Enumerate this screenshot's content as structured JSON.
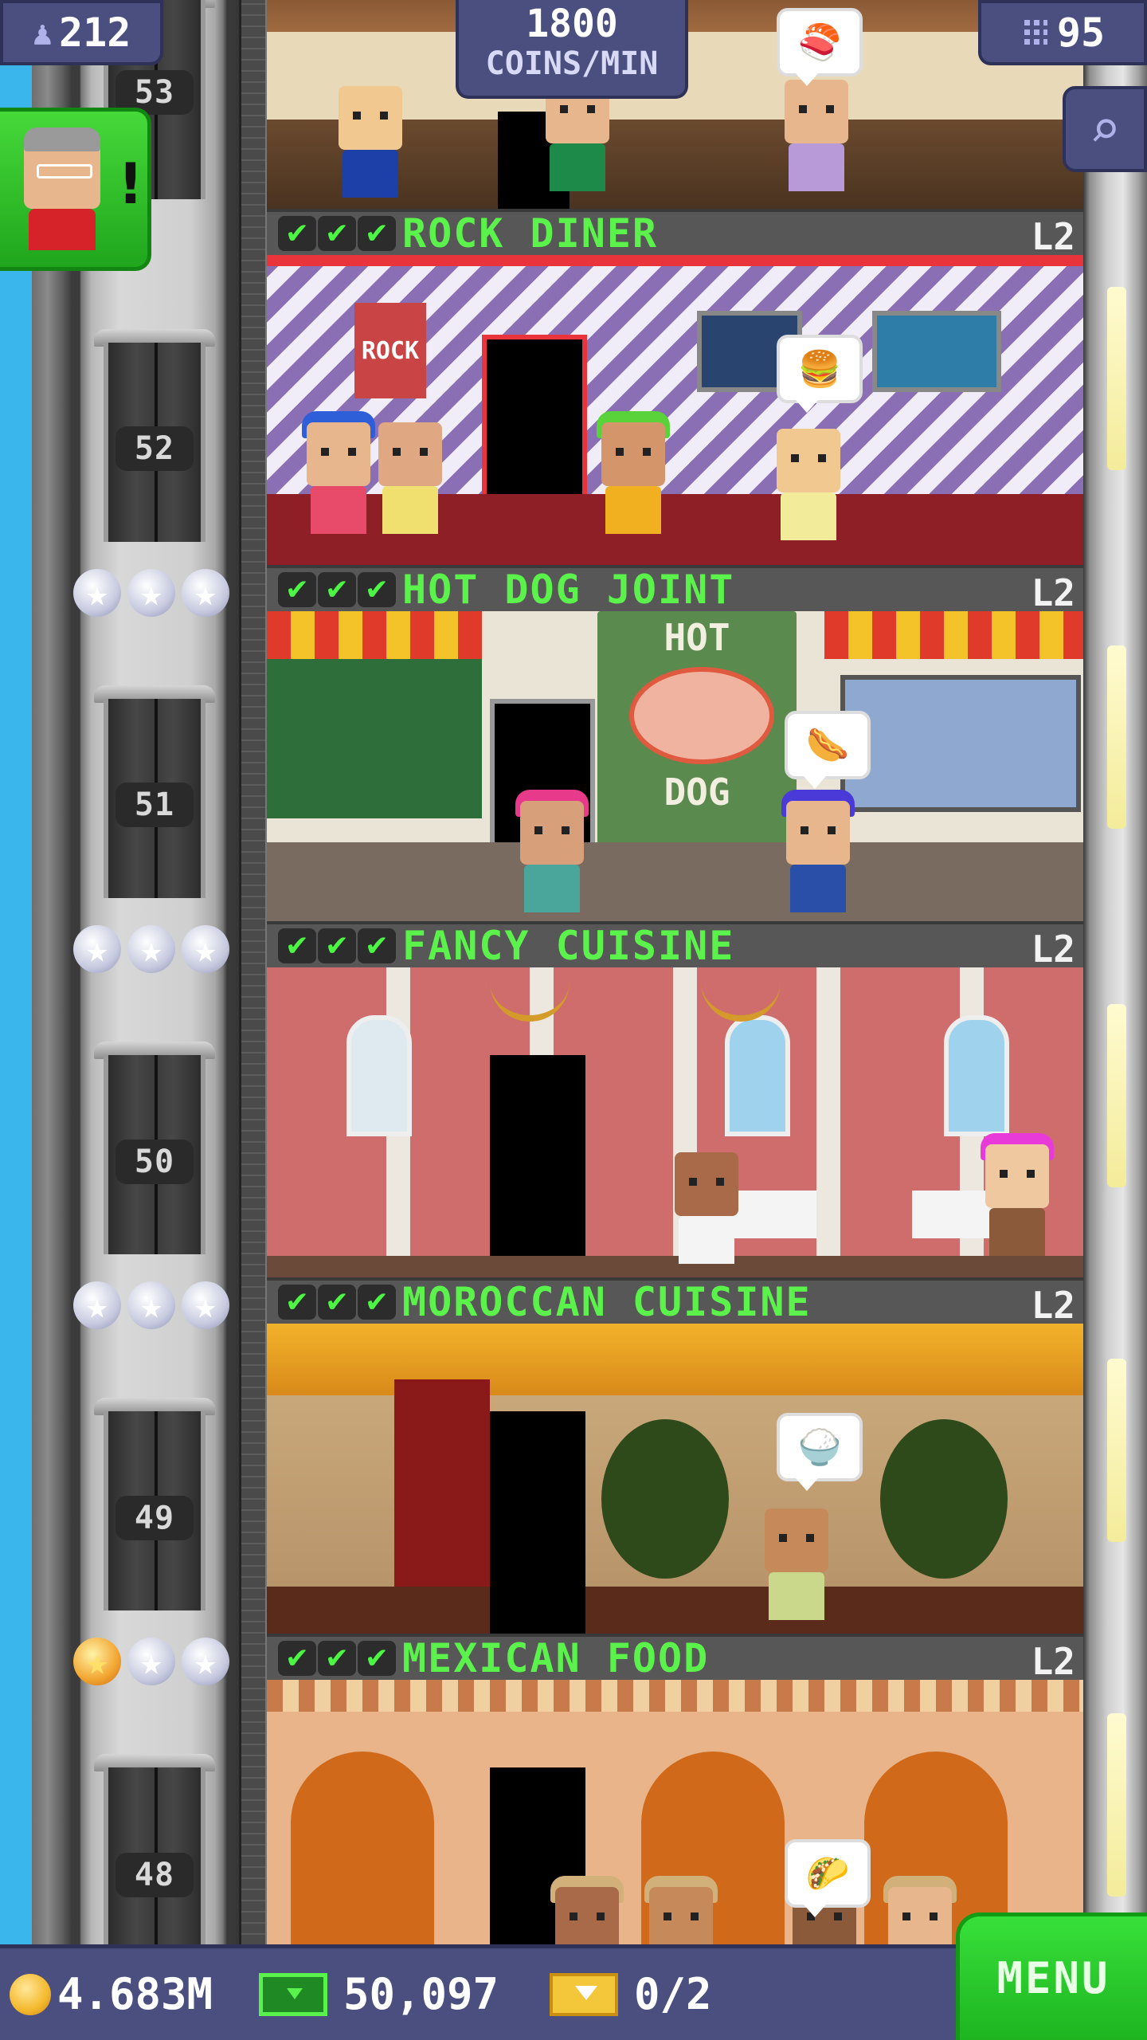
{
  "hud": {
    "population": "212",
    "coins_per_min_value": "1800",
    "coins_per_min_unit": "COINS/MIN",
    "floor_count": "95"
  },
  "elevator": {
    "floor_numbers": [
      "53",
      "52",
      "51",
      "50",
      "49",
      "48"
    ]
  },
  "top_floor": {
    "bubble_item": "sushi"
  },
  "floors": [
    {
      "title": "ROCK DINER",
      "level": "L2",
      "checks": 3,
      "stars_gold": 0,
      "bubble": "🍔",
      "sign": "ROCK"
    },
    {
      "title": "HOT DOG JOINT",
      "level": "L2",
      "checks": 3,
      "stars_gold": 0,
      "bubble": "🌭",
      "sign_top": "HOT",
      "sign_bottom": "DOG"
    },
    {
      "title": "FANCY CUISINE",
      "level": "L2",
      "checks": 3,
      "stars_gold": 0,
      "bubble": ""
    },
    {
      "title": "MOROCCAN CUISINE",
      "level": "L2",
      "checks": 3,
      "stars_gold": 0,
      "bubble": "🍚"
    },
    {
      "title": "MEXICAN FOOD",
      "level": "L2",
      "checks": 3,
      "stars_gold": 1,
      "bubble": "🌮"
    }
  ],
  "bottom_bar": {
    "coins": "4.683M",
    "bux": "50,097",
    "tickets": "0/2",
    "menu_label": "MENU"
  },
  "colors": {
    "hud_bg": "#4b4f80",
    "title_green": "#5cf24c",
    "menu_green": "#2cc92e",
    "sky": "#3bb6ec"
  },
  "icons": {
    "population": "person-icon",
    "floors": "building-icon",
    "zoom": "magnifier-icon",
    "coin": "coin-icon",
    "bux": "bux-icon",
    "ticket": "golden-ticket-icon",
    "check": "check-icon",
    "star": "star-icon"
  }
}
